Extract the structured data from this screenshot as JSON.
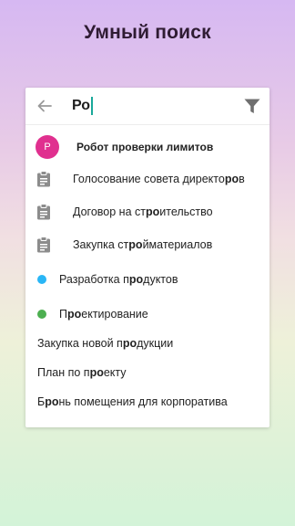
{
  "hero": {
    "title": "Умный поиск"
  },
  "search": {
    "query": "Ро",
    "icons": {
      "back": "arrow-left-icon",
      "filter": "funnel-icon"
    }
  },
  "results": [
    {
      "kind": "person",
      "avatar_letter": "Р",
      "avatar_color": "#e0308f",
      "pre": "",
      "bold": "Робот проверки лимитов",
      "post": ""
    },
    {
      "kind": "document",
      "icon": "clipboard-icon",
      "pre": "Голосование совета директо",
      "bold": "ро",
      "post": "в"
    },
    {
      "kind": "document",
      "icon": "clipboard-icon",
      "pre": "Договор на ст",
      "bold": "ро",
      "post": "ительство"
    },
    {
      "kind": "document",
      "icon": "clipboard-icon",
      "pre": "Закупка ст",
      "bold": "ро",
      "post": "йматериалов"
    },
    {
      "kind": "project",
      "dot_color": "#29b6f6",
      "pre": "Разработка п",
      "bold": "ро",
      "post": "дуктов"
    },
    {
      "kind": "project",
      "dot_color": "#4caf50",
      "pre": "П",
      "bold": "ро",
      "post": "ектирование"
    },
    {
      "kind": "plain",
      "pre": "Закупка новой п",
      "bold": "ро",
      "post": "дукции"
    },
    {
      "kind": "plain",
      "pre": "План по п",
      "bold": "ро",
      "post": "екту"
    },
    {
      "kind": "plain",
      "pre": "Б",
      "bold": "ро",
      "post": "нь помещения для корпоратива"
    }
  ]
}
